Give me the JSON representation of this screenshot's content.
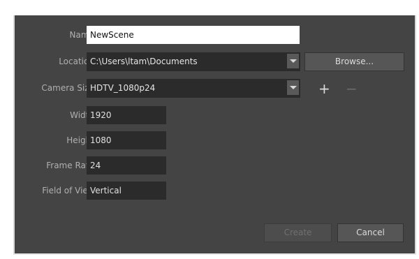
{
  "form": {
    "name": {
      "label": "Name:",
      "value": "NewScene"
    },
    "location": {
      "label": "Location:",
      "value": "C:\\Users\\ltam\\Documents",
      "browse_label": "Browse..."
    },
    "camera_size": {
      "label": "Camera Size:",
      "value": "HDTV_1080p24",
      "add_label": "+",
      "remove_label": "−"
    },
    "width": {
      "label": "Width:",
      "value": "1920"
    },
    "height": {
      "label": "Height:",
      "value": "1080"
    },
    "frame_rate": {
      "label": "Frame Rate:",
      "value": "24"
    },
    "field_of_view": {
      "label": "Field of View:",
      "value": "Vertical"
    }
  },
  "buttons": {
    "create_label": "Create",
    "cancel_label": "Cancel"
  },
  "icons": {
    "dropdown": "chevron-down-icon",
    "add": "plus-icon",
    "remove": "minus-icon"
  },
  "colors": {
    "dialog_bg": "#444444",
    "field_dark": "#2b2b2b",
    "label": "#b0b0b0"
  }
}
